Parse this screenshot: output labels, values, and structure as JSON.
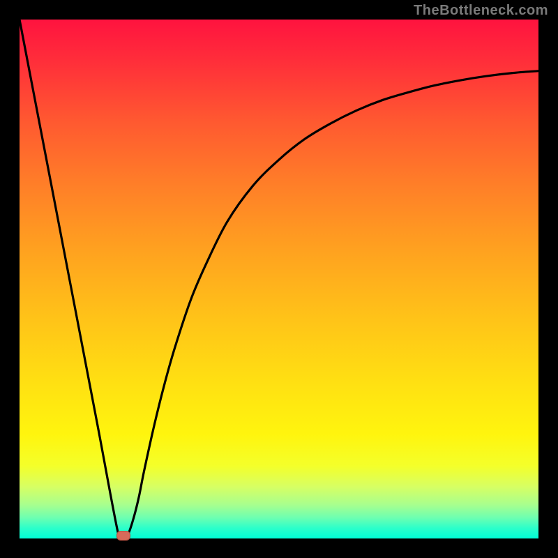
{
  "watermark": "TheBottleneck.com",
  "colors": {
    "frame": "#000000",
    "curve": "#000000",
    "marker_fill": "#d76a5a",
    "marker_border": "#b64f3f"
  },
  "chart_data": {
    "type": "line",
    "title": "",
    "xlabel": "",
    "ylabel": "",
    "xlim": [
      0,
      100
    ],
    "ylim": [
      0,
      100
    ],
    "grid": false,
    "legend": false,
    "series": [
      {
        "name": "bottleneck-curve",
        "x": [
          0,
          5,
          10,
          15,
          19,
          20,
          21,
          22,
          23,
          24,
          26,
          28,
          30,
          33,
          36,
          40,
          45,
          50,
          55,
          60,
          65,
          70,
          75,
          80,
          85,
          90,
          95,
          100
        ],
        "y": [
          100,
          74,
          48,
          22,
          1,
          0,
          1,
          4,
          8,
          13,
          22,
          30,
          37,
          46,
          53,
          61,
          68,
          73,
          77,
          80,
          82.5,
          84.5,
          86,
          87.3,
          88.3,
          89.1,
          89.7,
          90.1
        ]
      }
    ],
    "annotations": [
      {
        "kind": "marker",
        "x": 20,
        "y": 0.5,
        "shape": "pill"
      }
    ]
  }
}
